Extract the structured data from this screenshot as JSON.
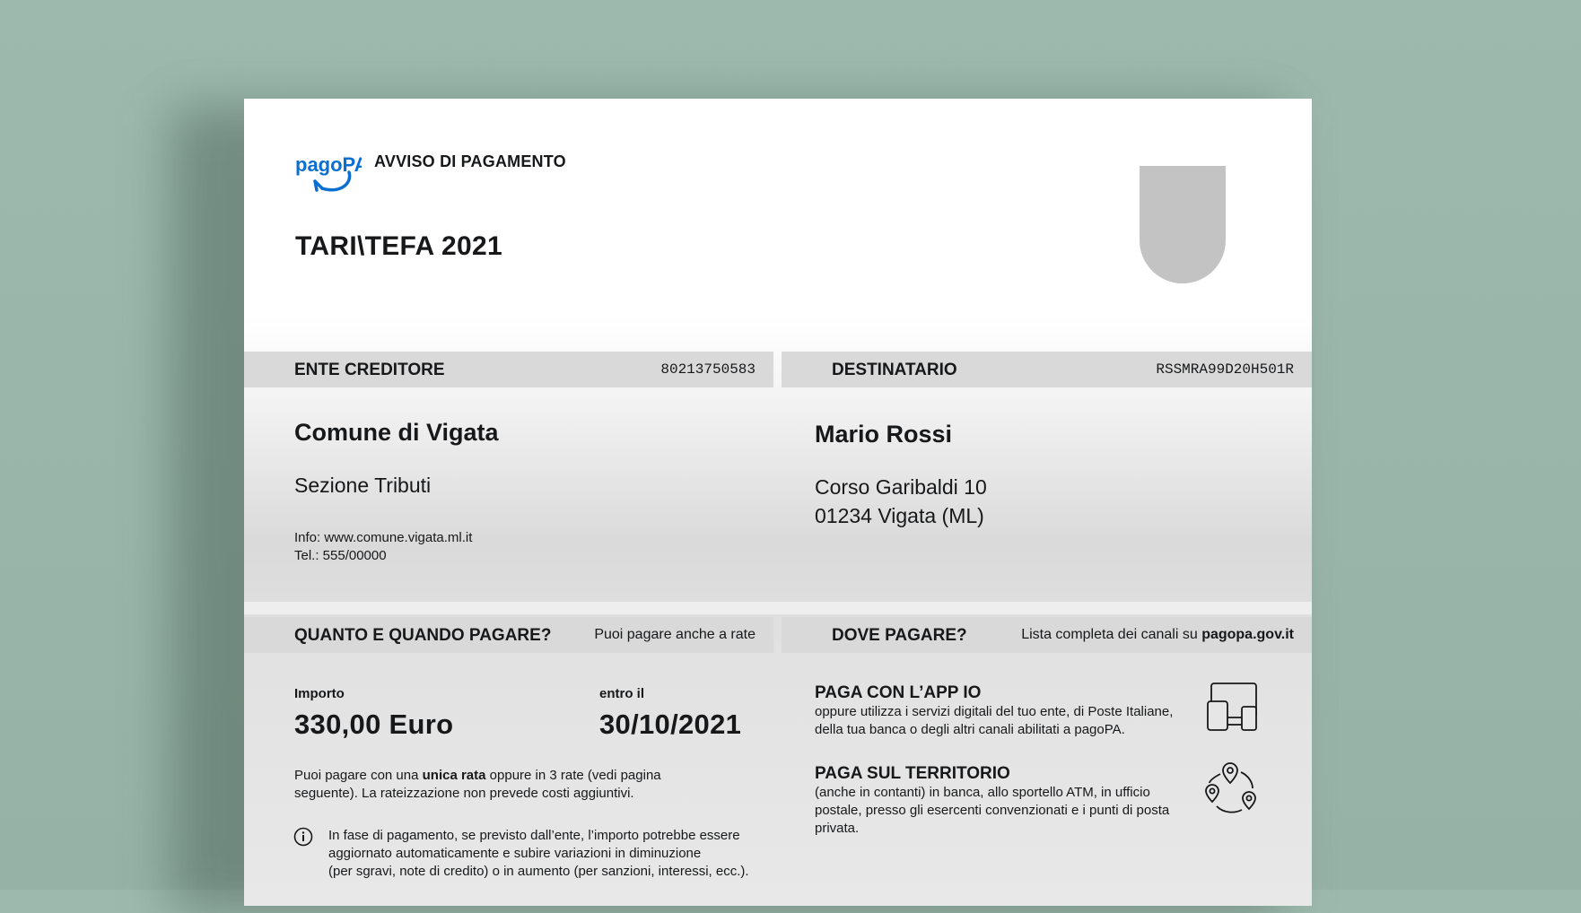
{
  "header": {
    "logo_text": "pagoPA",
    "notice_title": "AVVISO DI PAGAMENTO",
    "doc_title": "TARI\\TEFA 2021"
  },
  "creditor": {
    "label": "ENTE CREDITORE",
    "code": "80213750583",
    "name": "Comune di Vigata",
    "section": "Sezione Tributi",
    "info": "Info:  www.comune.vigata.ml.it",
    "tel": "Tel.: 555/00000"
  },
  "recipient": {
    "label": "DESTINATARIO",
    "code": "RSSMRA99D20H501R",
    "name": "Mario Rossi",
    "address_line1": "Corso Garibaldi 10",
    "address_line2": "01234 Vigata (ML)"
  },
  "payment": {
    "label": "QUANTO E QUANDO PAGARE?",
    "note": "Puoi pagare anche a rate",
    "amount_label": "Importo",
    "amount_value": "330,00 Euro",
    "due_label": "entro il",
    "due_value": "30/10/2021",
    "rate_pre": "Puoi pagare con una ",
    "rate_bold": "unica rata",
    "rate_post": "  oppure in 3 rate (vedi pagina",
    "rate_line2": "seguente). La rateizzazione non prevede costi aggiuntivi.",
    "info_line1": "In fase di pagamento, se previsto dall’ente, l’importo potrebbe essere",
    "info_line2": "aggiornato automaticamente e subire variazioni in diminuzione",
    "info_line3": "(per sgravi, note di credito) o in aumento (per sanzioni, interessi, ecc.)."
  },
  "where": {
    "label": "DOVE PAGARE?",
    "note_pre": "Lista completa dei canali su ",
    "note_link": "pagopa.gov.it",
    "app_title": "PAGA CON L’APP IO",
    "app_line1": "oppure utilizza i servizi digitali del tuo ente, di Poste Italiane,",
    "app_line2": "della tua banca o degli altri canali abilitati a pagoPA.",
    "territory_title": "PAGA SUL TERRITORIO",
    "territory_line1": "(anche in contanti) in banca, allo sportello ATM, in ufficio",
    "territory_line2": "postale, presso gli esercenti convenzionati e i punti di posta",
    "territory_line3": "privata."
  },
  "colors": {
    "background": "#9db9ad",
    "brand_blue": "#0b6fd1",
    "band_gray": "#d9d9d9",
    "crest_gray": "#c3c3c3"
  },
  "icons": [
    "pagopa-logo",
    "devices-icon",
    "location-pins-icon",
    "info-icon"
  ]
}
